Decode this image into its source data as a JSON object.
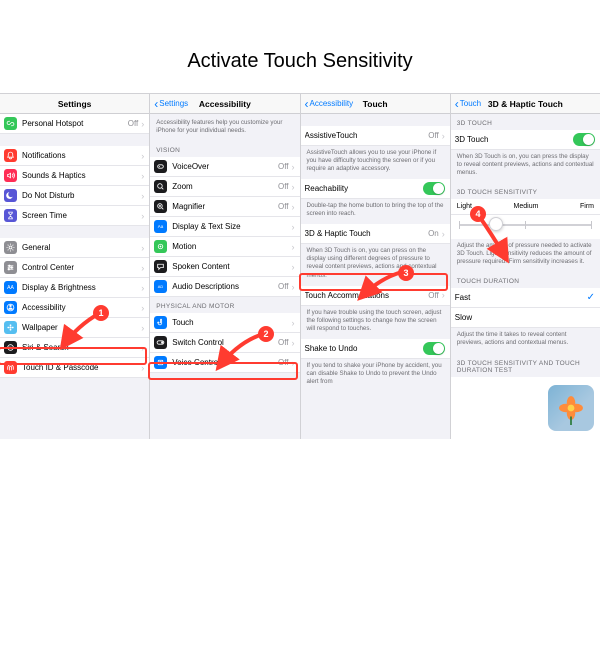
{
  "title": "Activate Touch Sensitivity",
  "pane1": {
    "nav_title": "Settings",
    "items": [
      {
        "label": "Personal Hotspot",
        "val": "Off",
        "icon": "link",
        "bg": "#34c759"
      },
      {
        "gap": true
      },
      {
        "label": "Notifications",
        "icon": "bell",
        "bg": "#ff3b30"
      },
      {
        "label": "Sounds & Haptics",
        "icon": "speaker",
        "bg": "#ff2d55"
      },
      {
        "label": "Do Not Disturb",
        "icon": "moon",
        "bg": "#5856d6"
      },
      {
        "label": "Screen Time",
        "icon": "hourglass",
        "bg": "#5856d6"
      },
      {
        "gap": true
      },
      {
        "label": "General",
        "icon": "gear",
        "bg": "#8e8e93"
      },
      {
        "label": "Control Center",
        "icon": "sliders",
        "bg": "#8e8e93"
      },
      {
        "label": "Display & Brightness",
        "icon": "sun",
        "bg": "#007aff"
      },
      {
        "label": "Accessibility",
        "icon": "person",
        "bg": "#007aff",
        "highlight": true
      },
      {
        "label": "Wallpaper",
        "icon": "flower",
        "bg": "#55bef0"
      },
      {
        "label": "Siri & Search",
        "icon": "siri",
        "bg": "#1c1c1e"
      },
      {
        "label": "Touch ID & Passcode",
        "icon": "finger",
        "bg": "#ff3b30"
      }
    ]
  },
  "pane2": {
    "back": "Settings",
    "nav_title": "Accessibility",
    "intro": "Accessibility features help you customize your iPhone for your individual needs.",
    "section_vision": "VISION",
    "section_motor": "PHYSICAL AND MOTOR",
    "vision_items": [
      {
        "label": "VoiceOver",
        "val": "Off",
        "icon": "voiceover",
        "bg": "#1c1c1e"
      },
      {
        "label": "Zoom",
        "val": "Off",
        "icon": "zoom",
        "bg": "#1c1c1e"
      },
      {
        "label": "Magnifier",
        "val": "Off",
        "icon": "magnifier",
        "bg": "#1c1c1e"
      },
      {
        "label": "Display & Text Size",
        "icon": "textsize",
        "bg": "#007aff"
      },
      {
        "label": "Motion",
        "icon": "motion",
        "bg": "#34c759"
      },
      {
        "label": "Spoken Content",
        "icon": "bubble",
        "bg": "#1c1c1e"
      },
      {
        "label": "Audio Descriptions",
        "val": "Off",
        "icon": "ad",
        "bg": "#007aff"
      }
    ],
    "motor_items": [
      {
        "label": "Touch",
        "icon": "touch",
        "bg": "#007aff",
        "highlight": true
      },
      {
        "label": "Switch Control",
        "val": "Off",
        "icon": "switch",
        "bg": "#1c1c1e"
      },
      {
        "label": "Voice Control",
        "val": "Off",
        "icon": "voice",
        "bg": "#007aff"
      }
    ]
  },
  "pane3": {
    "back": "Accessibility",
    "nav_title": "Touch",
    "at_label": "AssistiveTouch",
    "at_val": "Off",
    "at_foot": "AssistiveTouch allows you to use your iPhone if you have difficulty touching the screen or if you require an adaptive accessory.",
    "reach_label": "Reachability",
    "reach_foot": "Double-tap the home button to bring the top of the screen into reach.",
    "haptic_label": "3D & Haptic Touch",
    "haptic_val": "On",
    "haptic_foot": "When 3D Touch is on, you can press on the display using different degrees of pressure to reveal content previews, actions and contextual menus.",
    "ta_label": "Touch Accommodations",
    "ta_val": "Off",
    "ta_foot": "If you have trouble using the touch screen, adjust the following settings to change how the screen will respond to touches.",
    "shake_label": "Shake to Undo",
    "shake_foot": "If you tend to shake your iPhone by accident, you can disable Shake to Undo to prevent the Undo alert from"
  },
  "pane4": {
    "back": "Touch",
    "nav_title": "3D & Haptic Touch",
    "sec_3d": "3D TOUCH",
    "toggle_label": "3D Touch",
    "toggle_foot": "When 3D Touch is on, you can press the display to reveal content previews, actions and contextual menus.",
    "sec_sens": "3D TOUCH SENSITIVITY",
    "sens_light": "Light",
    "sens_medium": "Medium",
    "sens_firm": "Firm",
    "sens_foot": "Adjust the amount of pressure needed to activate 3D Touch. Light sensitivity reduces the amount of pressure required. Firm sensitivity increases it.",
    "sec_dur": "TOUCH DURATION",
    "dur_fast": "Fast",
    "dur_slow": "Slow",
    "dur_foot": "Adjust the time it takes to reveal content previews, actions and contextual menus.",
    "sec_test": "3D TOUCH SENSITIVITY AND TOUCH DURATION TEST"
  },
  "badges": {
    "b1": "1",
    "b2": "2",
    "b3": "3",
    "b4": "4"
  }
}
